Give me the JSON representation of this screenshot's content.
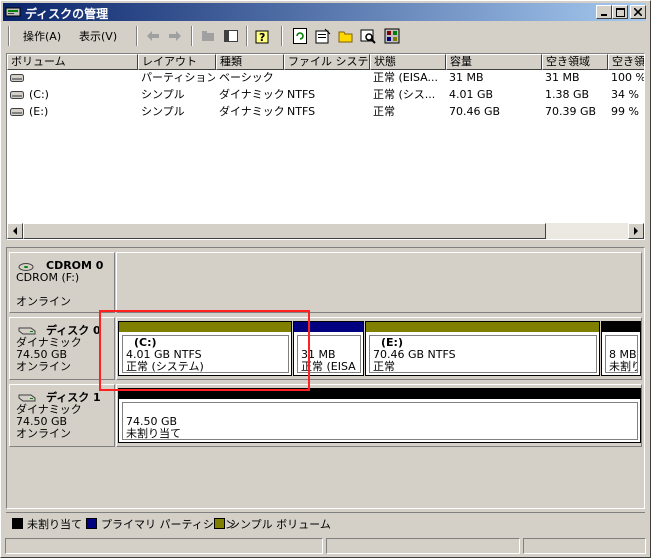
{
  "window": {
    "title": "ディスクの管理"
  },
  "menu": {
    "action": "操作(A)",
    "view": "表示(V)"
  },
  "toolbar": {
    "icons": [
      "back-arrow-icon",
      "forward-arrow-icon",
      "properties-folder-icon",
      "panel-icon",
      "help-icon",
      "refresh-icon",
      "properties-icon",
      "open-folder-icon",
      "explore-icon",
      "settings-icon"
    ]
  },
  "volume_list": {
    "columns": [
      "ボリューム",
      "レイアウト",
      "種類",
      "ファイル システム",
      "状態",
      "容量",
      "空き領域",
      "空き領"
    ],
    "rows": [
      [
        "",
        "パーティション",
        "ベーシック",
        "",
        "正常 (EISA...",
        "31 MB",
        "31 MB",
        "100 %"
      ],
      [
        "(C:)",
        "シンプル",
        "ダイナミック",
        "NTFS",
        "正常 (シス...",
        "4.01 GB",
        "1.38 GB",
        "34 %"
      ],
      [
        "(E:)",
        "シンプル",
        "ダイナミック",
        "NTFS",
        "正常",
        "70.46 GB",
        "70.39 GB",
        "99 %"
      ]
    ]
  },
  "disks": [
    {
      "name": "CDROM 0",
      "line1": "CDROM (F:)",
      "line2": "",
      "status": "オンライン",
      "volumes": []
    },
    {
      "name": "ディスク 0",
      "line1": "ダイナミック",
      "line2": "74.50 GB",
      "status": "オンライン",
      "volumes": [
        {
          "label": "(C:)",
          "size": "4.01 GB NTFS",
          "state": "正常 (システム)",
          "type": "simple"
        },
        {
          "label": "",
          "size": "31 MB",
          "state": "正常 (EISA",
          "type": "primary"
        },
        {
          "label": "(E:)",
          "size": "70.46 GB NTFS",
          "state": "正常",
          "type": "simple"
        },
        {
          "label": "",
          "size": "8 MB",
          "state": "未割り",
          "type": "unallocated"
        }
      ]
    },
    {
      "name": "ディスク 1",
      "line1": "ダイナミック",
      "line2": "74.50 GB",
      "status": "オンライン",
      "volumes": [
        {
          "label": "",
          "size": "74.50 GB",
          "state": "未割り当て",
          "type": "unallocated"
        }
      ]
    }
  ],
  "legend": [
    {
      "label": "未割り当て",
      "color": "#000000"
    },
    {
      "label": "プライマリ パーティション",
      "color": "#000080"
    },
    {
      "label": "シンプル ボリューム",
      "color": "#808000"
    }
  ],
  "colors": {
    "simple": "#808000",
    "primary": "#000080",
    "unallocated": "#000000",
    "highlight": "#ff2020"
  }
}
